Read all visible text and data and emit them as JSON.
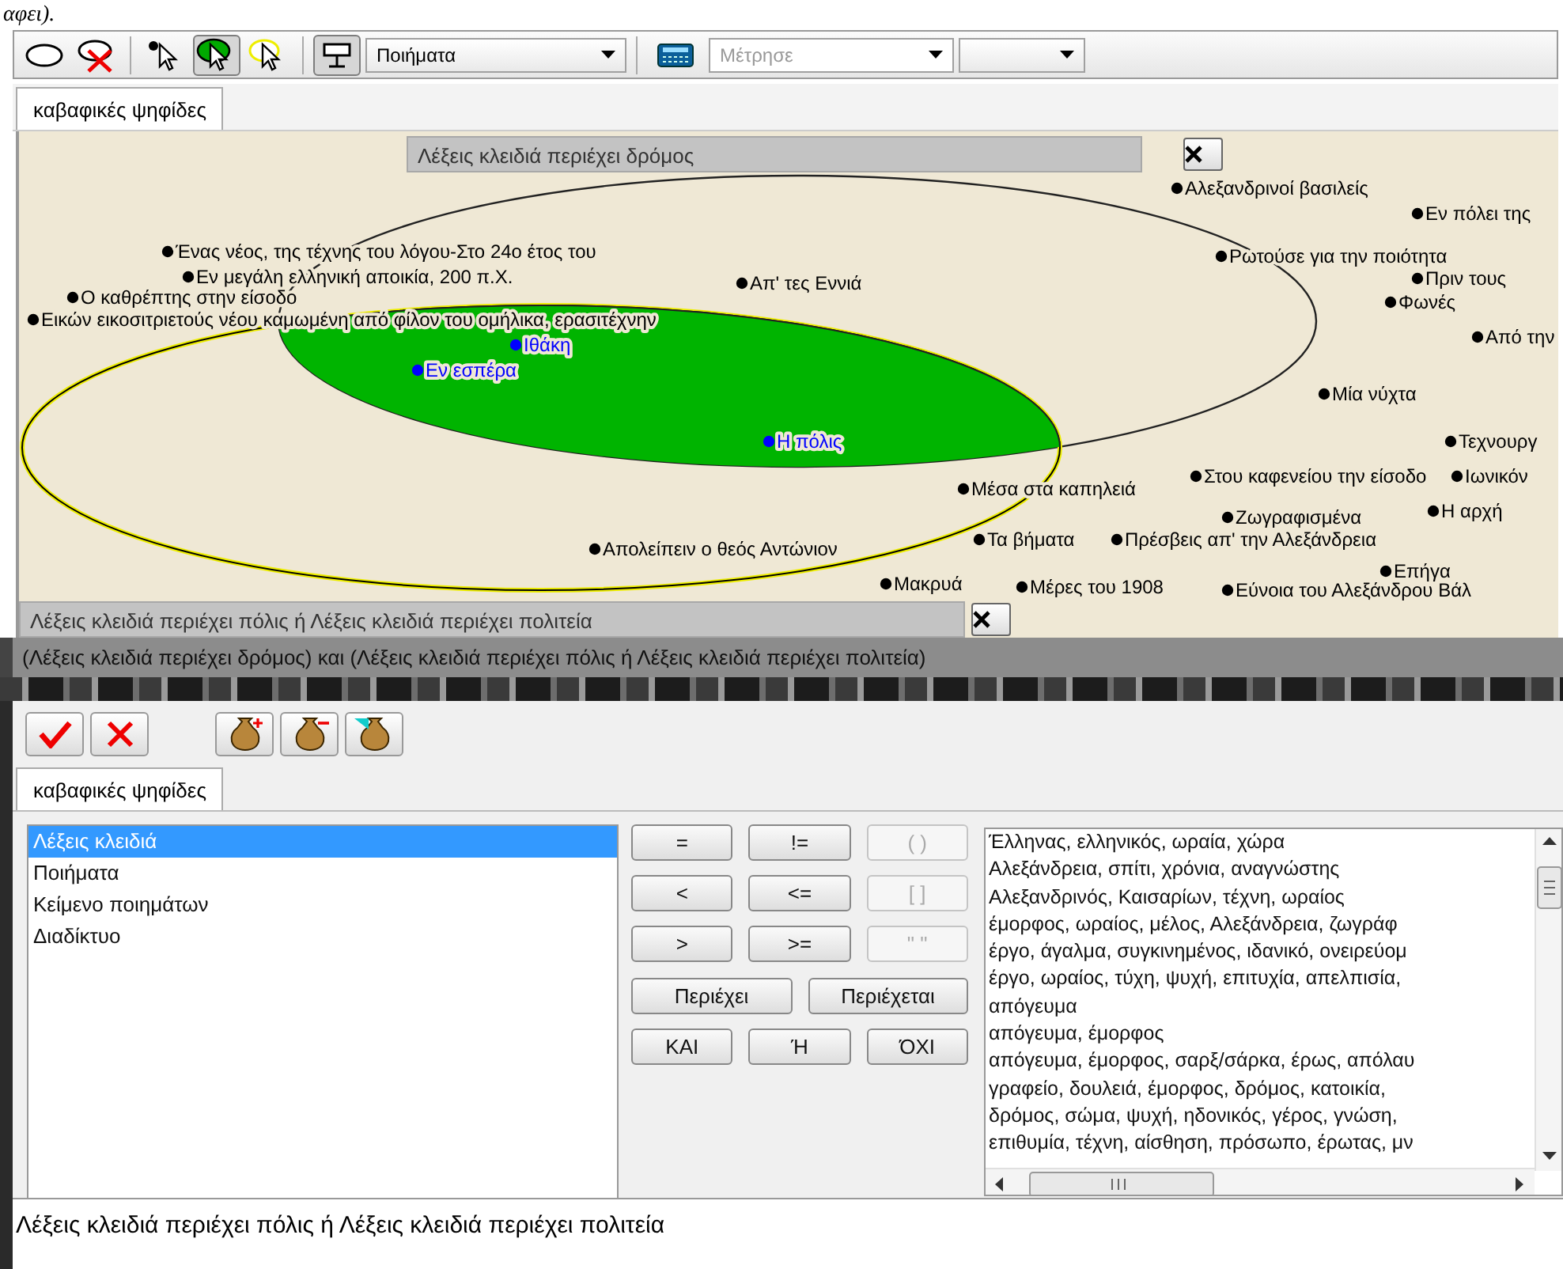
{
  "top_fragment": "αφει).",
  "toolbar": {
    "tools": [
      {
        "kind": "ellipse",
        "pressed": false
      },
      {
        "kind": "ellipse-delete",
        "pressed": false
      },
      {
        "kind": "point-pointer",
        "pressed": false
      },
      {
        "kind": "green-pointer",
        "pressed": true
      },
      {
        "kind": "yellow-pointer",
        "pressed": false
      },
      {
        "kind": "display",
        "pressed": true
      }
    ],
    "collection_select": "Ποιήματα",
    "measure_select": {
      "value": "Μέτρησε",
      "disabled": true
    }
  },
  "canvas_tab": {
    "label": "καβαφικές ψηφίδες",
    "selected": true
  },
  "sets": [
    {
      "title": "Λέξεις κλειδιά περιέχει δρόμος"
    },
    {
      "title": "Λέξεις κλειδιά περιέχει πόλις ή Λέξεις κλειδιά περιέχει πολιτεία"
    }
  ],
  "points": [
    {
      "label": "Ένας νέος, της τέχνης του λόγου-Στο 24ο έτος του",
      "color": "#000000"
    },
    {
      "label": "Εν μεγάλη ελληνική αποικία, 200 π.Χ.",
      "color": "#000000"
    },
    {
      "label": "Ο καθρέπτης στην είσοδο",
      "color": "#000000"
    },
    {
      "label": "Εικών εικοσιτριετούς νέου καμωμένη από φίλον του ομήλικα, ερασιτέχνην",
      "color": "#000000"
    },
    {
      "label": "Απ' τες Εννιά",
      "color": "#000000"
    },
    {
      "label": "Ιθάκη",
      "color": "#0000ff"
    },
    {
      "label": "Εν εσπέρα",
      "color": "#0000ff"
    },
    {
      "label": "Η πόλις",
      "color": "#0000ff"
    },
    {
      "label": "Αλεξανδρινοί βασιλείς",
      "color": "#000000"
    },
    {
      "label": "Εν πόλει της",
      "color": "#000000"
    },
    {
      "label": "Ρωτούσε για την ποιότητα",
      "color": "#000000"
    },
    {
      "label": "Πριν τους",
      "color": "#000000"
    },
    {
      "label": "Φωνές",
      "color": "#000000"
    },
    {
      "label": "Από την",
      "color": "#000000"
    },
    {
      "label": "Μία νύχτα",
      "color": "#000000"
    },
    {
      "label": "Τεχνουργ",
      "color": "#000000"
    },
    {
      "label": "Μέσα στα καπηλειά",
      "color": "#000000"
    },
    {
      "label": "Στου καφενείου την είσοδο",
      "color": "#000000"
    },
    {
      "label": "Ιωνικόν",
      "color": "#000000"
    },
    {
      "label": "Ζωγραφισμένα",
      "color": "#000000"
    },
    {
      "label": "Η αρχή",
      "color": "#000000"
    },
    {
      "label": "Τα βήματα",
      "color": "#000000"
    },
    {
      "label": "Πρέσβεις απ' την Αλεξάνδρεια",
      "color": "#000000"
    },
    {
      "label": "Απολείπειν ο θεός Αντώνιον",
      "color": "#000000"
    },
    {
      "label": "Μακρυά",
      "color": "#000000"
    },
    {
      "label": "Μέρες του 1908",
      "color": "#000000"
    },
    {
      "label": "Επήγα",
      "color": "#000000"
    },
    {
      "label": "Εύνοια του Αλεξάνδρου Βάλ",
      "color": "#000000"
    }
  ],
  "query_status": "(Λέξεις κλειδιά περιέχει δρόμος) και (Λέξεις κλειδιά περιέχει πόλις ή Λέξεις κλειδιά περιέχει πολιτεία)",
  "query_tools": [
    {
      "kind": "accept"
    },
    {
      "kind": "cancel"
    },
    {
      "kind": "bag-add"
    },
    {
      "kind": "bag-remove"
    },
    {
      "kind": "bag-select"
    }
  ],
  "query_tab": {
    "label": "καβαφικές ψηφίδες",
    "selected": true
  },
  "fields": [
    {
      "label": "Λέξεις κλειδιά",
      "selected": true
    },
    {
      "label": "Ποιήματα",
      "selected": false
    },
    {
      "label": "Κείμενο ποιημάτων",
      "selected": false
    },
    {
      "label": "Διαδίκτυο",
      "selected": false
    }
  ],
  "operators": [
    {
      "label": "=",
      "disabled": false
    },
    {
      "label": "!=",
      "disabled": false
    },
    {
      "label": "( )",
      "disabled": true
    },
    {
      "label": "<",
      "disabled": false
    },
    {
      "label": "<=",
      "disabled": false
    },
    {
      "label": "[ ]",
      "disabled": true
    },
    {
      "label": ">",
      "disabled": false
    },
    {
      "label": ">=",
      "disabled": false
    },
    {
      "label": "\" \"",
      "disabled": true
    }
  ],
  "text_operators": [
    "Περιέχει",
    "Περιέχεται"
  ],
  "logic_operators": [
    "ΚΑΙ",
    "Ή",
    "ΌΧΙ"
  ],
  "values": [
    "Έλληνας, ελληνικός, ωραία, χώρα",
    "Αλεξάνδρεια, σπίτι, χρόνια, αναγνώστης",
    "Αλεξανδρινός, Καισαρίων, τέχνη, ωραίος",
    "έμορφος, ωραίος, μέλος, Αλεξάνδρεια, ζωγράφ",
    "έργο, άγαλμα, συγκινημένος, ιδανικό, ονειρεύομ",
    "έργο, ωραίος, τύχη, ψυχή, επιτυχία, απελπισία,",
    "απόγευμα",
    "απόγευμα, έμορφος",
    "απόγευμα, έμορφος, σαρξ/σάρκα, έρως, απόλαυ",
    "γραφείο, δουλειά, έμορφος, δρόμος, κατοικία,",
    "δρόμος, σώμα, ψυχή, ηδονικός, γέρος, γνώση,",
    "επιθυμία, τέχνη, αίσθηση, πρόσωπο, έρωτας, μν"
  ],
  "expression": "Λέξεις κλειδιά περιέχει πόλις ή Λέξεις κλειδιά περιέχει πολιτεία"
}
